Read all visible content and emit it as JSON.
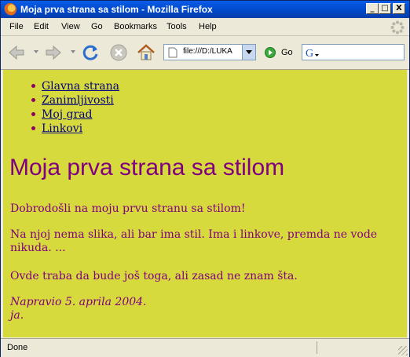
{
  "window": {
    "title": "Moja prva strana sa stilom - Mozilla Firefox",
    "buttons": {
      "minimize": "_",
      "maximize": "□",
      "close": "X"
    }
  },
  "menubar": {
    "items": [
      {
        "label": "File"
      },
      {
        "label": "Edit"
      },
      {
        "label": "View"
      },
      {
        "label": "Go"
      },
      {
        "label": "Bookmarks"
      },
      {
        "label": "Tools"
      },
      {
        "label": "Help"
      }
    ]
  },
  "navbar": {
    "url": "file:///D:/LUKA",
    "go_label": "Go",
    "search_value": ""
  },
  "page": {
    "nav_links": [
      "Glavna strana",
      "Zanimljivosti",
      "Moj grad",
      "Linkovi"
    ],
    "heading": "Moja prva strana sa stilom",
    "paragraphs": [
      "Dobrodošli na moju prvu stranu sa stilom!",
      "Na njoj nema slika, ali bar ima stil. Ima i linkove, premda ne vode nikuda. ...",
      "Ovde traba da bude još toga, ali zasad ne znam šta."
    ],
    "signature_line1": "Napravio 5. aprila 2004.",
    "signature_line2": "ja."
  },
  "statusbar": {
    "text": "Done"
  },
  "colors": {
    "page_background": "#d7da3c",
    "heading_color": "#800080",
    "link_color": "#000080"
  }
}
